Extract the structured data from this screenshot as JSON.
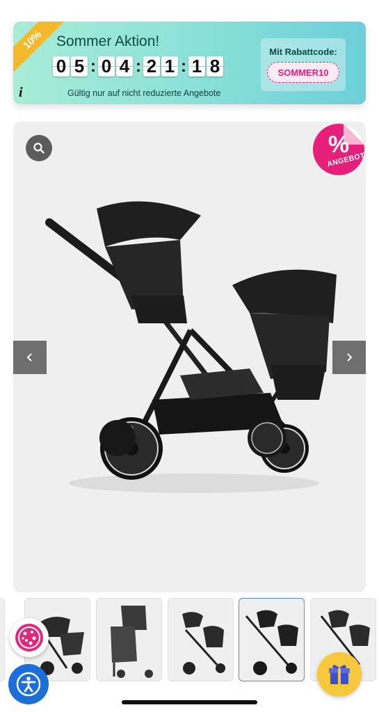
{
  "promo": {
    "ribbon": "10%",
    "title": "Sommer Aktion!",
    "countdown": {
      "days": [
        "0",
        "5"
      ],
      "hours": [
        "0",
        "4"
      ],
      "minutes": [
        "2",
        "1"
      ],
      "seconds": [
        "1",
        "8"
      ]
    },
    "note": "Gültig nur auf nicht reduzierte Angebote",
    "code_label": "Mit Rabattcode:",
    "code": "SOMMER10",
    "info_icon": "info-icon"
  },
  "product": {
    "badge_symbol": "%",
    "badge_text": "ANGEBOT",
    "icons": {
      "zoom": "search-icon",
      "prev": "chevron-left-icon",
      "next": "chevron-right-icon"
    }
  },
  "thumbnails": {
    "count_visible": 6,
    "active_index": 4
  },
  "floating": {
    "cookie": "cookie-icon",
    "accessibility": "accessibility-icon",
    "gift": "gift-icon"
  },
  "colors": {
    "accent_pink": "#e51f7a",
    "banner_start": "#a7ecd7",
    "banner_end": "#6ccfd9",
    "ribbon": "#f4b92a",
    "accessibility_blue": "#1b6fd6",
    "gift_yellow": "#f7c83c"
  }
}
